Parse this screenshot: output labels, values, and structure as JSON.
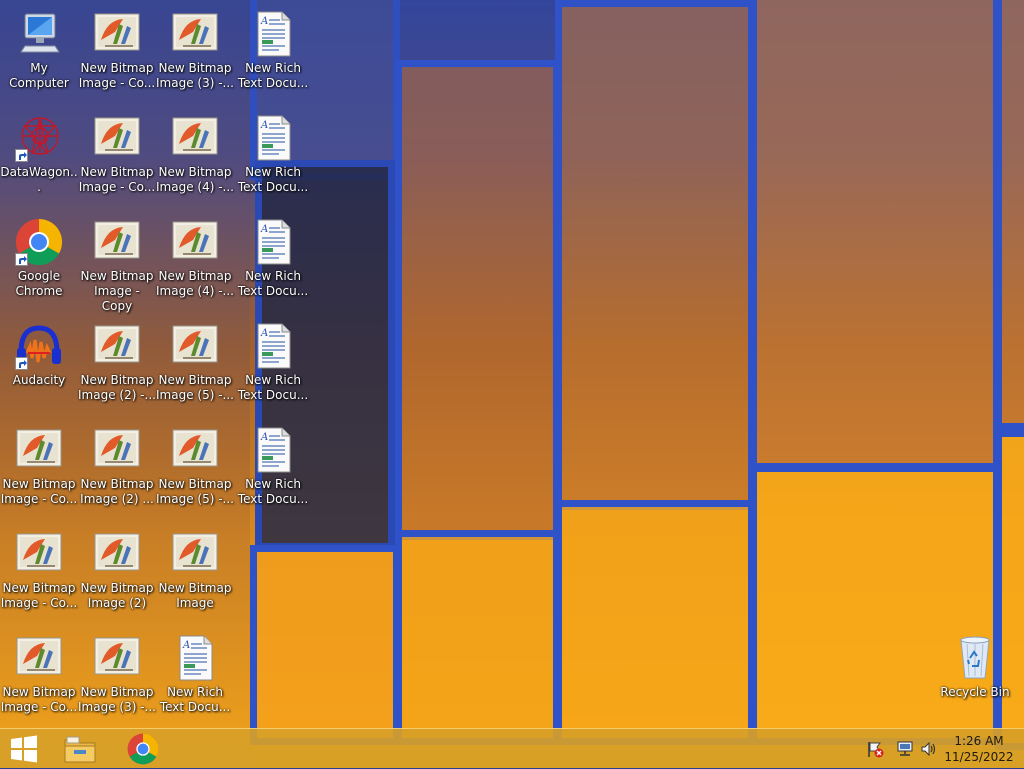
{
  "desktop": {
    "icons": [
      {
        "label": "My Computer",
        "kind": "computer-icon"
      },
      {
        "label": "DataWagon...",
        "kind": "datawagon-icon"
      },
      {
        "label": "Google\nChrome",
        "kind": "chrome-icon"
      },
      {
        "label": "Audacity",
        "kind": "audacity-icon"
      },
      {
        "label": "New Bitmap\nImage - Co...",
        "kind": "bitmap-icon"
      },
      {
        "label": "New Bitmap\nImage - Co...",
        "kind": "bitmap-icon"
      },
      {
        "label": "New Bitmap\nImage - Co...",
        "kind": "bitmap-icon"
      },
      {
        "label": "New Bitmap\nImage - Co...",
        "kind": "bitmap-icon"
      },
      {
        "label": "New Bitmap\nImage - Co...",
        "kind": "bitmap-icon"
      },
      {
        "label": "New Bitmap\nImage - Copy",
        "kind": "bitmap-icon"
      },
      {
        "label": "New Bitmap\nImage (2) -...",
        "kind": "bitmap-icon"
      },
      {
        "label": "New Bitmap\nImage (2) ...",
        "kind": "bitmap-icon"
      },
      {
        "label": "New Bitmap\nImage (2)",
        "kind": "bitmap-icon"
      },
      {
        "label": "New Bitmap\nImage (3) -...",
        "kind": "bitmap-icon"
      },
      {
        "label": "New Bitmap\nImage (3) -...",
        "kind": "bitmap-icon"
      },
      {
        "label": "New Bitmap\nImage (4) -...",
        "kind": "bitmap-icon"
      },
      {
        "label": "New Bitmap\nImage (4) -...",
        "kind": "bitmap-icon"
      },
      {
        "label": "New Bitmap\nImage (5) -...",
        "kind": "bitmap-icon"
      },
      {
        "label": "New Bitmap\nImage (5) -...",
        "kind": "bitmap-icon"
      },
      {
        "label": "New Bitmap\nImage",
        "kind": "bitmap-icon"
      },
      {
        "label": "New Rich\nText Docu...",
        "kind": "richtext-icon"
      },
      {
        "label": "New Rich\nText Docu...",
        "kind": "richtext-icon"
      },
      {
        "label": "New Rich\nText Docu...",
        "kind": "richtext-icon"
      },
      {
        "label": "New Rich\nText Docu...",
        "kind": "richtext-icon"
      },
      {
        "label": "New Rich\nText Docu...",
        "kind": "richtext-icon"
      },
      {
        "label": "New Rich\nText Docu...",
        "kind": "richtext-icon"
      },
      {
        "label": "Recycle Bin",
        "kind": "recycle-bin-icon"
      }
    ]
  },
  "taskbar": {
    "start": "start-button",
    "pinned": [
      "file-explorer-icon",
      "chrome-icon"
    ],
    "tray": [
      "action-center-flag-icon",
      "network-icon",
      "volume-icon"
    ],
    "clock": {
      "time": "1:26 AM",
      "date": "11/25/2022"
    }
  },
  "colors": {
    "taskbar": "#d7a028",
    "wallpaper_frame": "#2f52c8",
    "glass_orange": "#f2a516"
  }
}
